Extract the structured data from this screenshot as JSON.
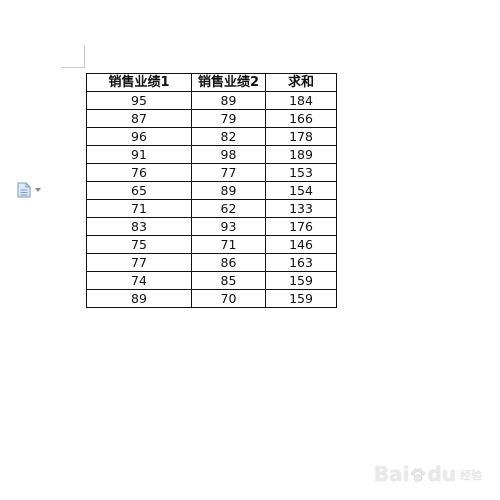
{
  "table": {
    "headers": [
      "销售业绩1",
      "销售业绩2",
      "求和"
    ],
    "rows": [
      [
        "95",
        "89",
        "184"
      ],
      [
        "87",
        "79",
        "166"
      ],
      [
        "96",
        "82",
        "178"
      ],
      [
        "91",
        "98",
        "189"
      ],
      [
        "76",
        "77",
        "153"
      ],
      [
        "65",
        "89",
        "154"
      ],
      [
        "71",
        "62",
        "133"
      ],
      [
        "83",
        "93",
        "176"
      ],
      [
        "75",
        "71",
        "146"
      ],
      [
        "77",
        "86",
        "163"
      ],
      [
        "74",
        "85",
        "159"
      ],
      [
        "89",
        "70",
        "159"
      ]
    ]
  },
  "icons": {
    "paste_options": "paste-options-icon",
    "dropdown": "chevron-down-icon"
  },
  "watermark": {
    "logo": "Bai",
    "logo_suffix": "du",
    "text": "经验"
  },
  "colors": {
    "border": "#111111",
    "icon_blue": "#7a9cc6",
    "watermark": "#e6e6e6"
  }
}
